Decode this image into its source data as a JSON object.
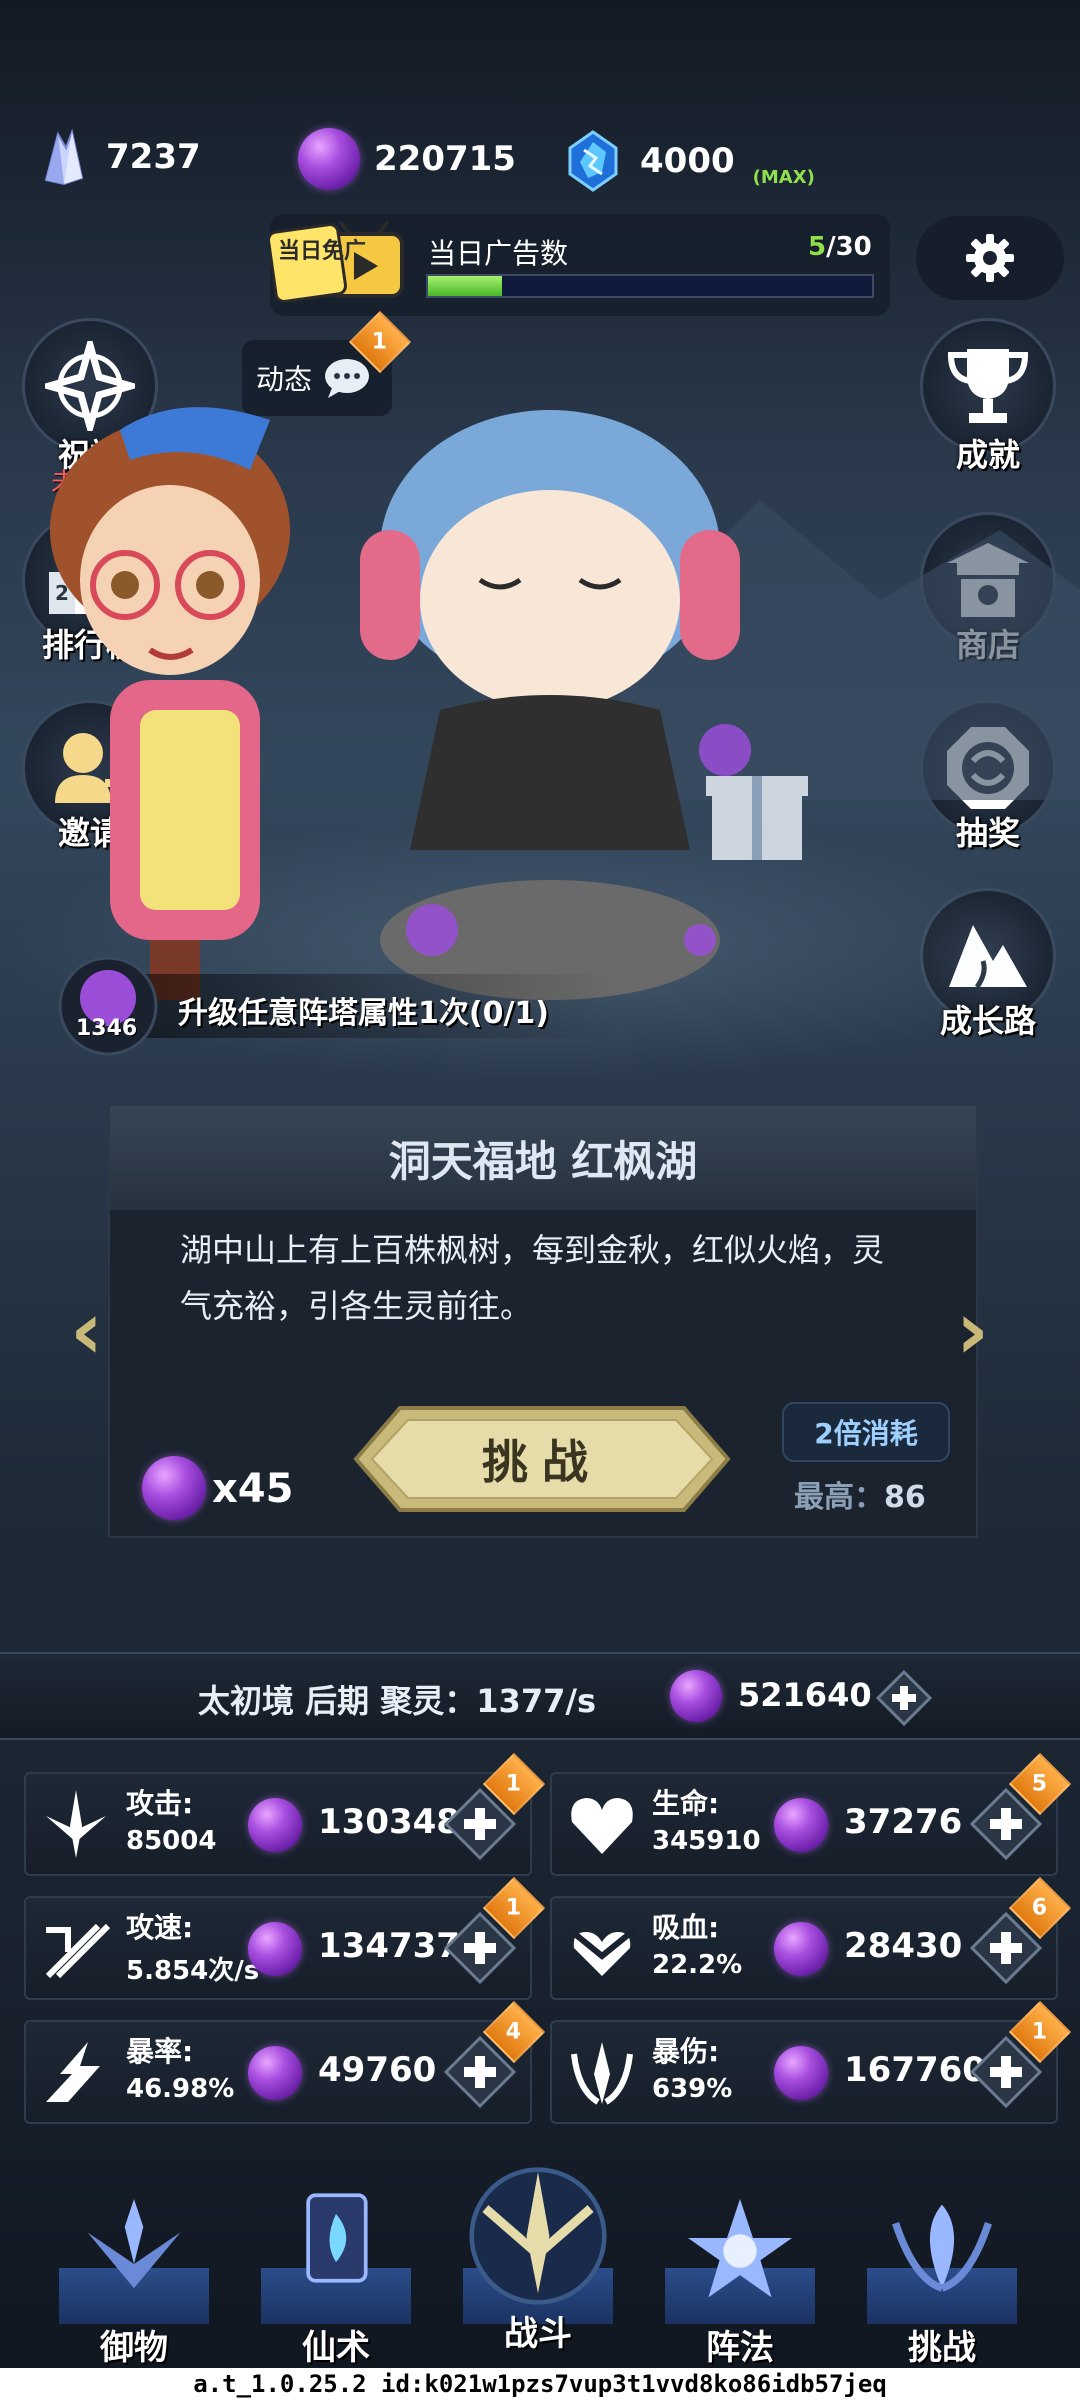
{
  "currency": {
    "crystals": "7237",
    "spirit_orbs": "220715",
    "energy": "4000",
    "energy_max_tag": "(MAX)"
  },
  "ad": {
    "icon_text": "当日免广",
    "title": "当日广告数",
    "current": "5",
    "total": "/30",
    "progress": 0.1667
  },
  "dynamics": {
    "label": "动态",
    "badge": "1"
  },
  "left_buttons": [
    {
      "label": "祝福",
      "sub": "未激活"
    },
    {
      "label": "排行榜"
    },
    {
      "label": "邀请"
    }
  ],
  "right_buttons": [
    {
      "label": "成就"
    },
    {
      "label": "商店"
    },
    {
      "label": "抽奖"
    },
    {
      "label": "成长路"
    }
  ],
  "quest": {
    "count": "1346",
    "text": "升级任意阵塔属性1次(0/1)"
  },
  "location": {
    "title": "洞天福地 红枫湖",
    "description": "湖中山上有上百株枫树，每到金秋，红似火焰，灵气充裕，引各生灵前往。",
    "challenge_label": "挑战",
    "cost": "x45",
    "double_label": "2倍消耗",
    "best_label": "最高：",
    "best_value": "86"
  },
  "cultivation": {
    "text": "太初境 后期 聚灵：1377/s",
    "orbs": "521640"
  },
  "stats": [
    {
      "name": "攻击:",
      "value": "85004",
      "cost": "130348",
      "badge": "1"
    },
    {
      "name": "生命:",
      "value": "345910",
      "cost": "37276",
      "badge": "5"
    },
    {
      "name": "攻速:",
      "value": "5.854次/s",
      "cost": "134737",
      "badge": "1"
    },
    {
      "name": "吸血:",
      "value": "22.2%",
      "cost": "28430",
      "badge": "6"
    },
    {
      "name": "暴率:",
      "value": "46.98%",
      "cost": "49760",
      "badge": "4"
    },
    {
      "name": "暴伤:",
      "value": "639%",
      "cost": "167760",
      "badge": "1"
    }
  ],
  "nav": [
    "御物",
    "仙术",
    "战斗",
    "阵法",
    "挑战"
  ],
  "debug_line": "a.t_1.0.25.2 id:k021w1pzs7vup3t1vvd8ko86idb57jeq",
  "colors": {
    "accent_green": "#8fe04a",
    "badge_orange": "#e07a10",
    "orb_purple": "#a84ee0"
  }
}
